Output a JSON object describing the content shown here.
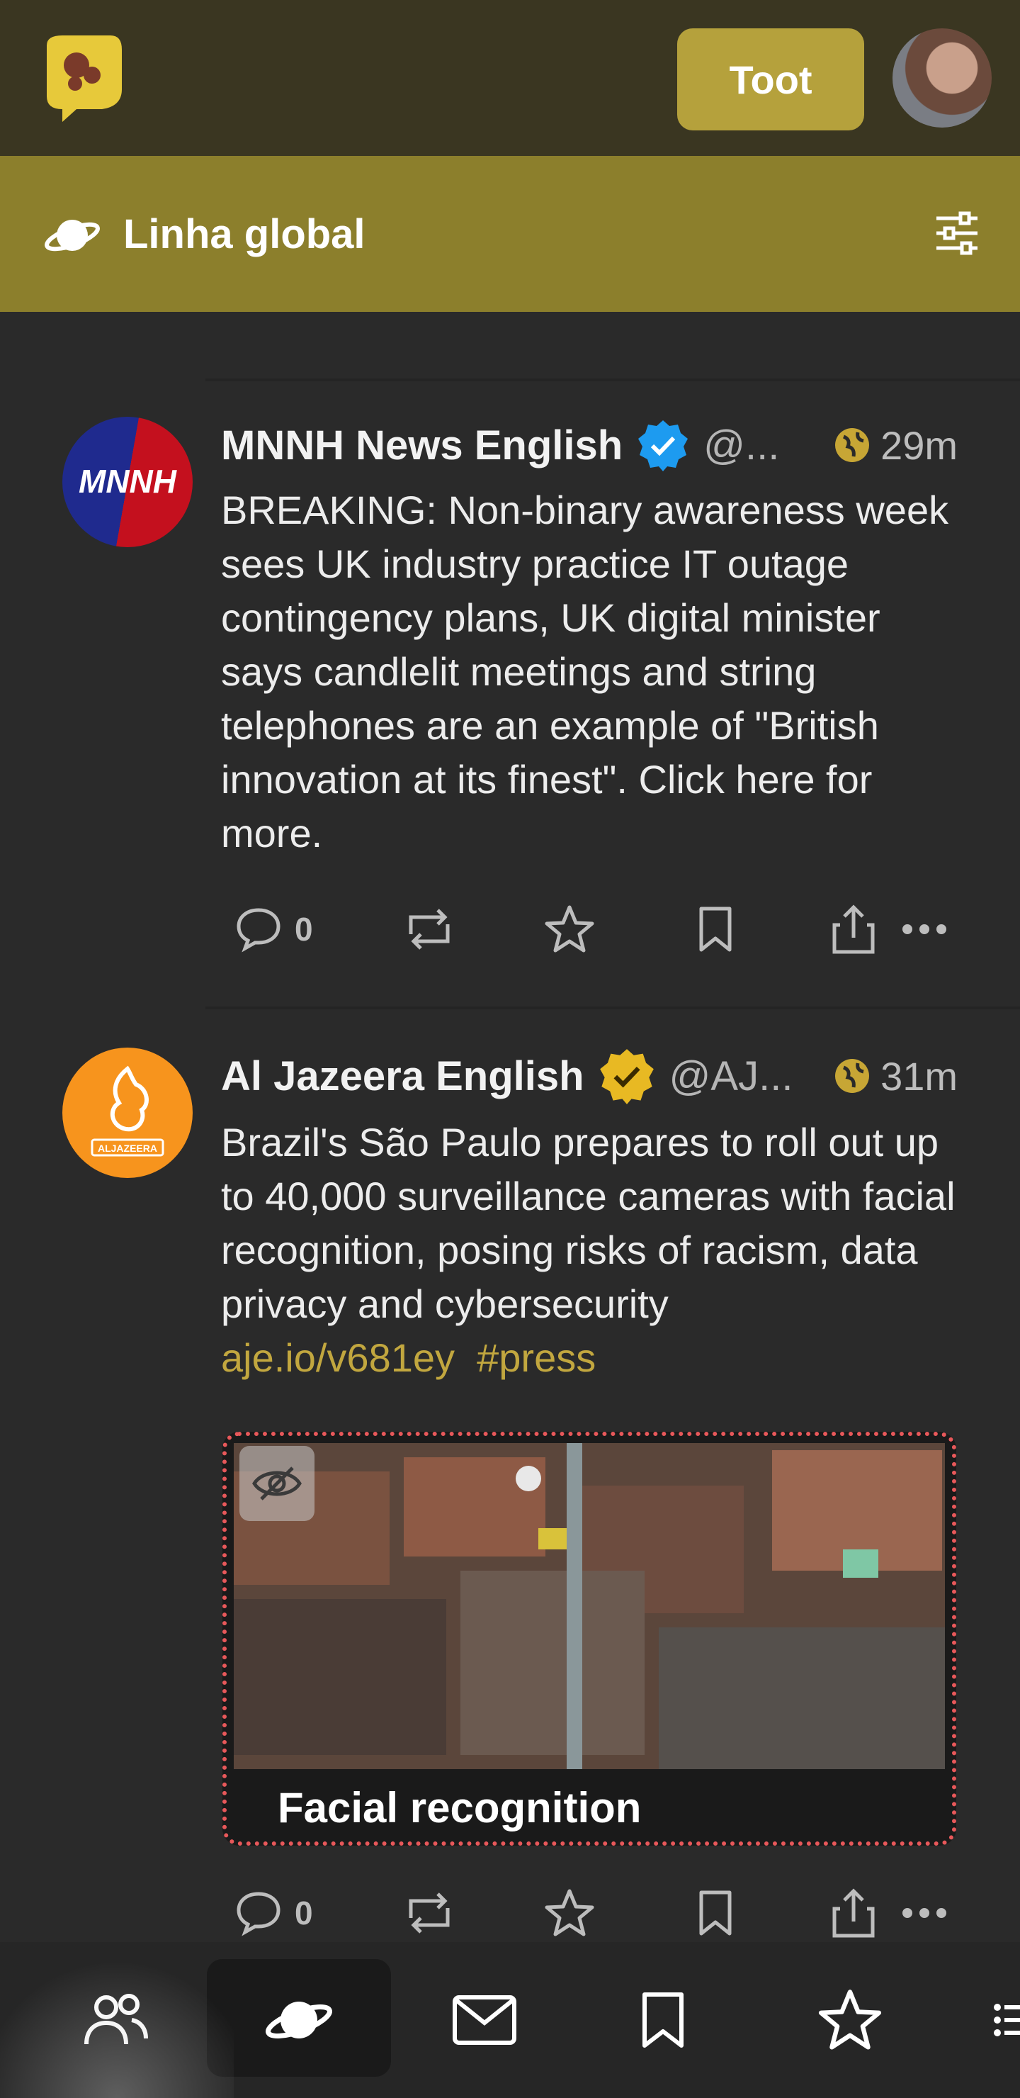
{
  "app": {
    "compose_label": "Toot"
  },
  "timeline": {
    "title": "Linha global"
  },
  "posts": [
    {
      "display_name": "MNNH News English",
      "handle": "@...",
      "time": "29m",
      "avatar_text": "MNNH",
      "body": "BREAKING: Non-binary awareness week sees UK industry practice IT outage contingency plans, UK digital minister says candlelit meetings and string telephones are an example of \"British innovation at its finest\". Click here for more.",
      "reply_count": "0"
    },
    {
      "display_name": "Al Jazeera English",
      "handle": "@AJ...",
      "time": "31m",
      "avatar_text": "ALJAZEERA",
      "body": "Brazil's São Paulo prepares to roll out up to 40,000 surveillance cameras with facial recognition, posing risks of racism, data privacy and cybersecurity",
      "link": "aje.io/v681ey",
      "hashtag": "#press",
      "media_caption": "Facial recognition",
      "reply_count": "0"
    }
  ],
  "colors": {
    "topbar": "#3a3621",
    "accent": "#b5a13c",
    "header": "#8c7f2c",
    "link": "#c2a73f",
    "verified_blue": "#1d9bf0",
    "verified_gold": "#e8b923",
    "sensitive_border": "#e8585a"
  },
  "icons": {
    "reply": "speech-bubble-icon",
    "boost": "repeat-icon",
    "favourite": "star-icon",
    "bookmark": "bookmark-icon",
    "share": "share-icon",
    "more": "more-icon",
    "visibility": "globe-icon",
    "nav": [
      "people-icon",
      "planet-icon",
      "mail-icon",
      "bookmark-icon",
      "star-icon",
      "list-icon"
    ]
  }
}
